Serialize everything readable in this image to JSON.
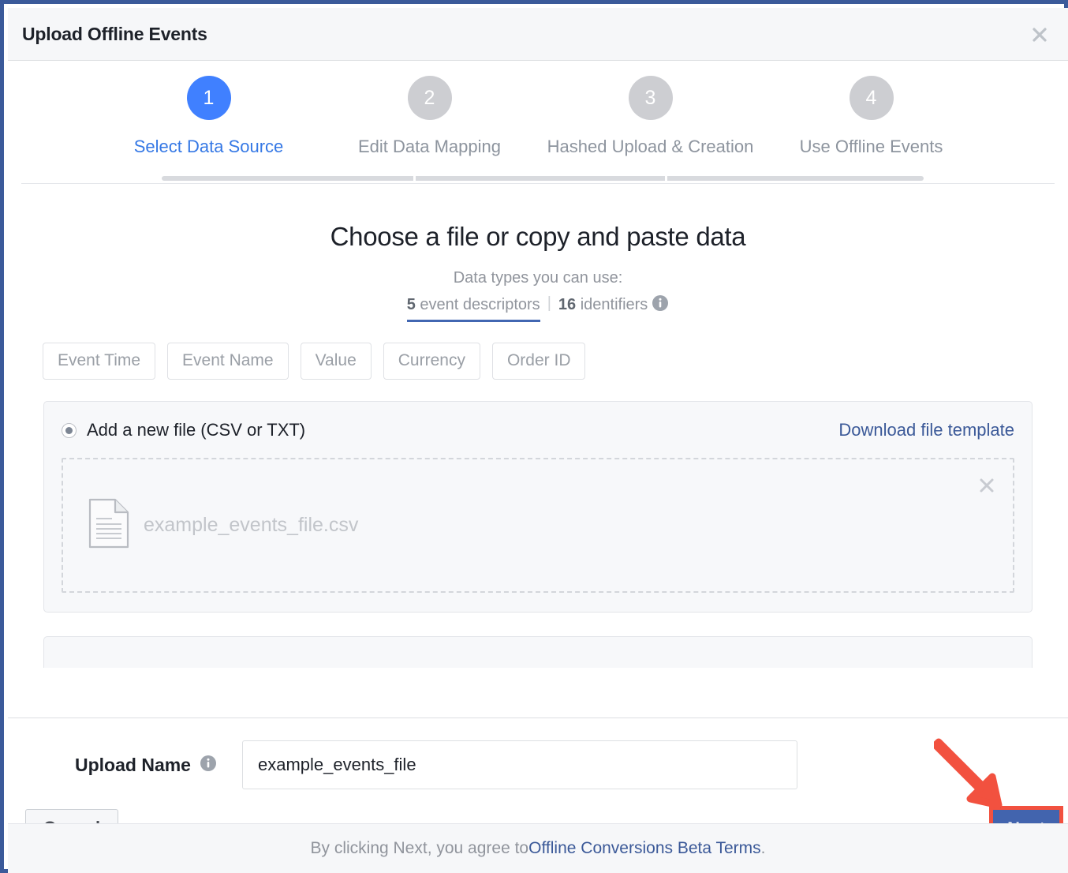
{
  "dialog": {
    "title": "Upload Offline Events",
    "close_icon": "close-icon"
  },
  "stepper": {
    "steps": [
      {
        "number": "1",
        "label": "Select Data Source",
        "state": "active"
      },
      {
        "number": "2",
        "label": "Edit Data Mapping",
        "state": "inactive"
      },
      {
        "number": "3",
        "label": "Hashed Upload & Creation",
        "state": "inactive"
      },
      {
        "number": "4",
        "label": "Use Offline Events",
        "state": "inactive"
      }
    ]
  },
  "main": {
    "heading": "Choose a file or copy and paste data",
    "subtitle": "Data types you can use:",
    "tabs": [
      {
        "count": "5",
        "label": " event descriptors",
        "selected": true
      },
      {
        "count": "16",
        "label": " identifiers",
        "selected": false
      }
    ],
    "separator": "|",
    "info_icon": "info-icon",
    "chips": [
      "Event Time",
      "Event Name",
      "Value",
      "Currency",
      "Order ID"
    ]
  },
  "file_panel": {
    "radio_label": "Add a new file (CSV or TXT)",
    "radio_selected": true,
    "download_link": "Download file template",
    "file_icon": "document-icon",
    "file_name": "example_events_file.csv",
    "remove_icon": "remove-file-icon"
  },
  "footer": {
    "upload_name_label": "Upload Name",
    "upload_name_info_icon": "info-icon",
    "upload_name_value": "example_events_file",
    "upload_name_placeholder": "Upload Name",
    "cancel_label": "Cancel",
    "next_label": "Next",
    "terms_prefix": "By clicking Next, you agree to ",
    "terms_link": "Offline Conversions Beta Terms",
    "terms_suffix": "."
  },
  "annotation": {
    "arrow_icon": "red-arrow-pointing-at-next",
    "highlight_icon": "red-highlight-box-around-next"
  },
  "colors": {
    "frame_border": "#3b5a9a",
    "active_step": "#4080ff",
    "active_step_label": "#3578e5",
    "inactive_step": "#cdced2",
    "link": "#3b5998",
    "tab_underline": "#4267b2",
    "next_button": "#4264ae",
    "annotation_red": "#f2513f",
    "header_bg": "#f6f7f9",
    "panel_bg": "#f7f8fa"
  }
}
